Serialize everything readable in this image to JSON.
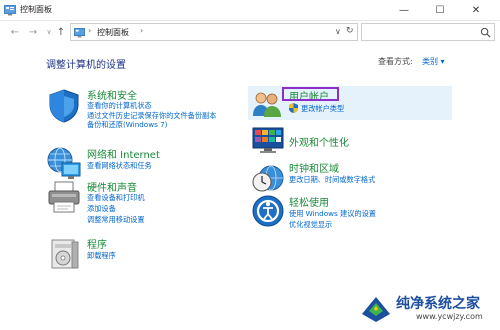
{
  "window": {
    "title": "控制面板",
    "minimize_glyph": "—",
    "maximize_glyph": "☐",
    "close_glyph": "✕"
  },
  "nav": {
    "back_glyph": "←",
    "forward_glyph": "→",
    "recent_glyph": "∨",
    "up_glyph": "↑",
    "address_sep": "›",
    "breadcrumb": "控制面板",
    "address_sep2": "›",
    "dropdown_glyph": "∨",
    "refresh_glyph": "↻",
    "search_placeholder": ""
  },
  "main": {
    "heading": "调整计算机的设置",
    "view_by_label": "查看方式:",
    "view_by_value": "类别 ▾"
  },
  "categories": [
    {
      "icon": "shield-icon",
      "title": "系统和安全",
      "links": [
        "查看你的计算机状态",
        "通过文件历史记录保存你的文件备份副本",
        "备份和还原(Windows 7)"
      ]
    },
    {
      "icon": "network-icon",
      "title": "网络和 Internet",
      "links": [
        "查看网络状态和任务"
      ]
    },
    {
      "icon": "printer-icon",
      "title": "硬件和声音",
      "links": [
        "查看设备和打印机",
        "添加设备",
        "调整常用移动设置"
      ]
    },
    {
      "icon": "programs-icon",
      "title": "程序",
      "links": [
        "卸载程序"
      ]
    },
    {
      "icon": "users-icon",
      "title": "用户帐户",
      "links": [
        "更改帐户类型"
      ]
    },
    {
      "icon": "appearance-icon",
      "title": "外观和个性化",
      "links": []
    },
    {
      "icon": "clock-globe-icon",
      "title": "时钟和区域",
      "links": [
        "更改日期、时间或数字格式"
      ]
    },
    {
      "icon": "accessibility-icon",
      "title": "轻松使用",
      "links": [
        "使用 Windows 建议的设置",
        "优化视觉显示"
      ]
    }
  ],
  "watermark": {
    "title": "纯净系统之家",
    "url": "www.ycwjzy.com"
  },
  "colors": {
    "heading": "#1e3287",
    "category_title": "#1a8a3a",
    "link": "#0066cc",
    "highlight": "#e5f1fb",
    "annotation_box": "#8b2fc9"
  }
}
